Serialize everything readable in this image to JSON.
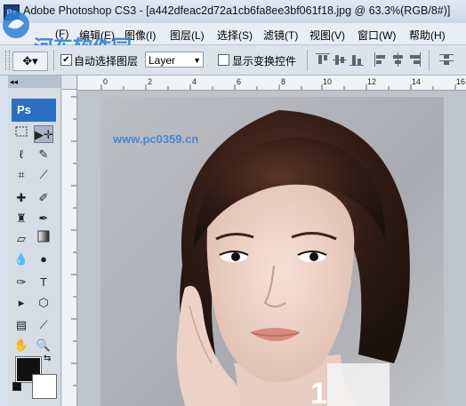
{
  "window": {
    "title": "Adobe Photoshop CS3 - [a442dfeac2d72a1cb6fa8ee3bf061f18.jpg @ 63.3%(RGB/8#)]"
  },
  "menu": {
    "items": [
      {
        "label": "(F)"
      },
      {
        "label": "编辑(E)"
      },
      {
        "label": "图像(I)"
      },
      {
        "label": "图层(L)"
      },
      {
        "label": "选择(S)"
      },
      {
        "label": "滤镜(T)"
      },
      {
        "label": "视图(V)"
      },
      {
        "label": "窗口(W)"
      },
      {
        "label": "帮助(H)"
      }
    ]
  },
  "options": {
    "auto_select_label": "自动选择图层",
    "auto_select_checked": true,
    "layer_select_value": "Layer",
    "show_transform_label": "显示变换控件",
    "show_transform_checked": false
  },
  "toolbox": {
    "ps_label": "Ps",
    "collapse_label": "◂◂"
  },
  "ruler": {
    "h_labels": [
      "0",
      "2",
      "4",
      "6",
      "8",
      "10",
      "12",
      "14",
      "16"
    ]
  },
  "watermark": {
    "line1": "河东软件园",
    "line2": "www.pc0359.cn"
  },
  "colors": {
    "foreground": "#111111",
    "background": "#ffffff"
  }
}
